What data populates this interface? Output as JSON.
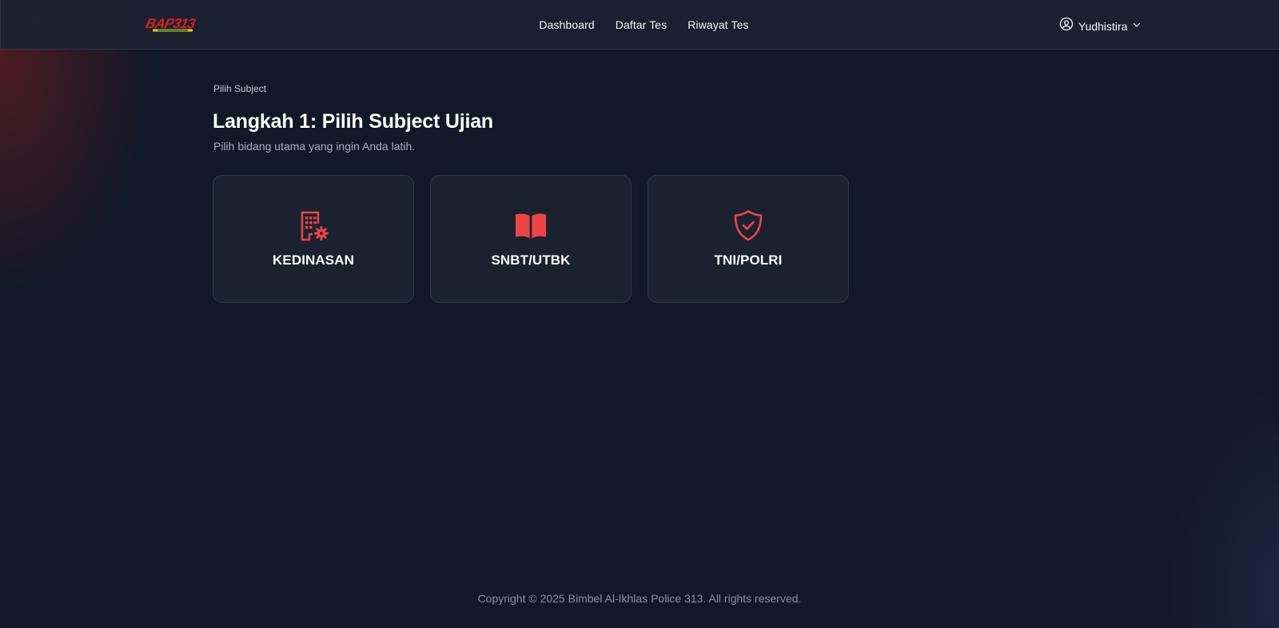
{
  "colors": {
    "accent": "#ef4444",
    "background": "#111827",
    "card_bg": "#1a2230",
    "navbar_bg": "#1b2230"
  },
  "navbar": {
    "logo_text": "BAP313",
    "links": [
      {
        "label": "Dashboard"
      },
      {
        "label": "Daftar Tes"
      },
      {
        "label": "Riwayat Tes"
      }
    ],
    "user": {
      "name": "Yudhistira",
      "icon": "user-circle-icon",
      "dropdown_icon": "chevron-down-icon"
    }
  },
  "main": {
    "breadcrumb": "Pilih Subject",
    "title": "Langkah 1: Pilih Subject Ujian",
    "subtitle": "Pilih bidang utama yang ingin Anda latih.",
    "subjects": [
      {
        "label": "KEDINASAN",
        "icon": "building-gear-icon"
      },
      {
        "label": "SNBT/UTBK",
        "icon": "open-book-icon"
      },
      {
        "label": "TNI/POLRI",
        "icon": "shield-check-icon"
      }
    ]
  },
  "footer": {
    "copyright": "Copyright © 2025 Bimbel Al-Ikhlas Police 313. All rights reserved."
  }
}
